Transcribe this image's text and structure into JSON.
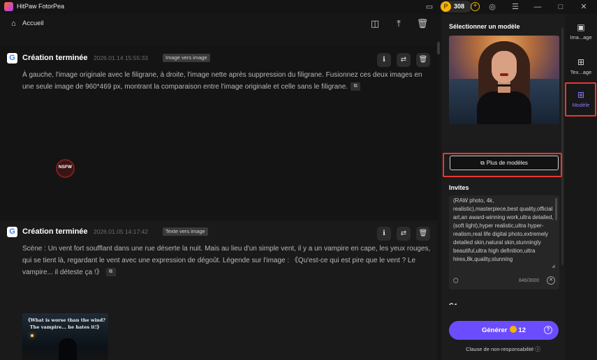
{
  "app": {
    "title": "HitPaw FotorPea",
    "credits": "308",
    "icons": [
      "book-icon",
      "coin-icon",
      "plus-icon",
      "user-icon",
      "menu-icon",
      "minimize-icon",
      "maximize-icon",
      "close-icon"
    ]
  },
  "nav": {
    "home_label": "Accueil"
  },
  "cards": [
    {
      "title": "Création terminée",
      "date": "2026.01.14  15:55:33",
      "tag": "Image vers image",
      "text": "À gauche, l'image originale avec le filigrane, à droite, l'image nette après suppression du filigrane. Fusionnez ces deux images en une seule image de 960*469 px, montrant la comparaison entre l'image originale et celle sans le filigrane.",
      "badge": "NSFW"
    },
    {
      "title": "Création terminée",
      "date": "2026.01.05  14:17:42",
      "tag": "Texte vers image",
      "text": "Scène : Un vent fort soufflant dans une rue déserte la nuit. Mais au lieu d'un simple vent, il y a un vampire en cape, les yeux rouges, qui se tient là, regardant le vent avec une expression de dégoût. Légende sur l'image : 《Qu'est-ce qui est pire que le vent ? Le vampire... il déteste ça !》",
      "thumb_caption_1": "《What is worse than the wind?",
      "thumb_caption_2": "The vampire... he hates it!》"
    }
  ],
  "panel": {
    "title": "Sélectionner un modèle",
    "more_models": "Plus de modèles",
    "invites_label": "Invites",
    "prompt": "(RAW photo, 4k, realistic),masterpiece,best quality,official art,an award-winning work,ultra detailed,(soft light),hyper realistic,ultra hyper-realism,real life digital photo,extremely detailed skin,natural skin,stunningly beautiful,ultra high definition,ultra hires,8k,quality,stunning",
    "char_count": "846/3000",
    "generate_label": "Générer",
    "generate_cost": "12",
    "disclaimer": "Clause de non-responsabilité"
  },
  "tools": [
    {
      "label": "Ima...age",
      "icon": "image-add-icon"
    },
    {
      "label": "Tex...age",
      "icon": "text-add-icon"
    },
    {
      "label": "Modèle",
      "icon": "model-grid-icon",
      "active": true
    }
  ],
  "colors": {
    "accent": "#6b4dff",
    "coin": "#f4b400",
    "highlight": "#e53935"
  }
}
